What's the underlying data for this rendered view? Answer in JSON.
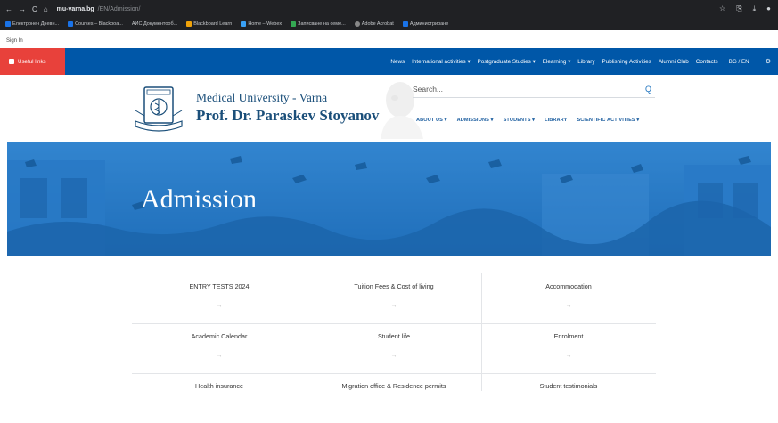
{
  "browser": {
    "nav_icons": [
      "←",
      "→",
      "C",
      "⌂"
    ],
    "url_domain": "mu-varna.bg",
    "url_path": "/EN/Admission/",
    "right_icons": [
      "☆",
      "⎘",
      "⤓",
      "●"
    ]
  },
  "bookmarks": [
    "Електронен Дневн...",
    "Courses – Blackboa...",
    "АИС Документооб...",
    "Blackboard Learn",
    "Home – Webex",
    "Записване на семе...",
    "Adobe Acrobat",
    "Администриране"
  ],
  "signin": "Sign In",
  "topnav": {
    "useful_links": "Useful links",
    "items": [
      "News",
      "International activities ▾",
      "Postgraduate Studies ▾",
      "Elearning ▾",
      "Library",
      "Publishing Activities",
      "Alumni Club",
      "Contacts"
    ],
    "lang": "BG / EN",
    "settings_icon": "⚙"
  },
  "header": {
    "uni_line1": "Medical University - Varna",
    "uni_line2": "Prof. Dr. Paraskev Stoyanov",
    "search_placeholder": "Search...",
    "search_icon": "Q",
    "mainnav": [
      "ABOUT US ▾",
      "ADMISSIONS ▾",
      "STUDENTS ▾",
      "LIBRARY",
      "SCIENTIFIC ACTIVITIES ▾"
    ]
  },
  "hero": {
    "title": "Admission",
    "color": "#2a7fcd"
  },
  "grid": {
    "arrow": "→",
    "rows": [
      [
        "ENTRY TESTS 2024",
        "Tuition Fees & Cost of living",
        "Accommodation"
      ],
      [
        "Academic Calendar",
        "Student life",
        "Enrolment"
      ],
      [
        "Health insurance",
        "Migration office & Residence permits",
        "Student testimonials"
      ]
    ]
  }
}
